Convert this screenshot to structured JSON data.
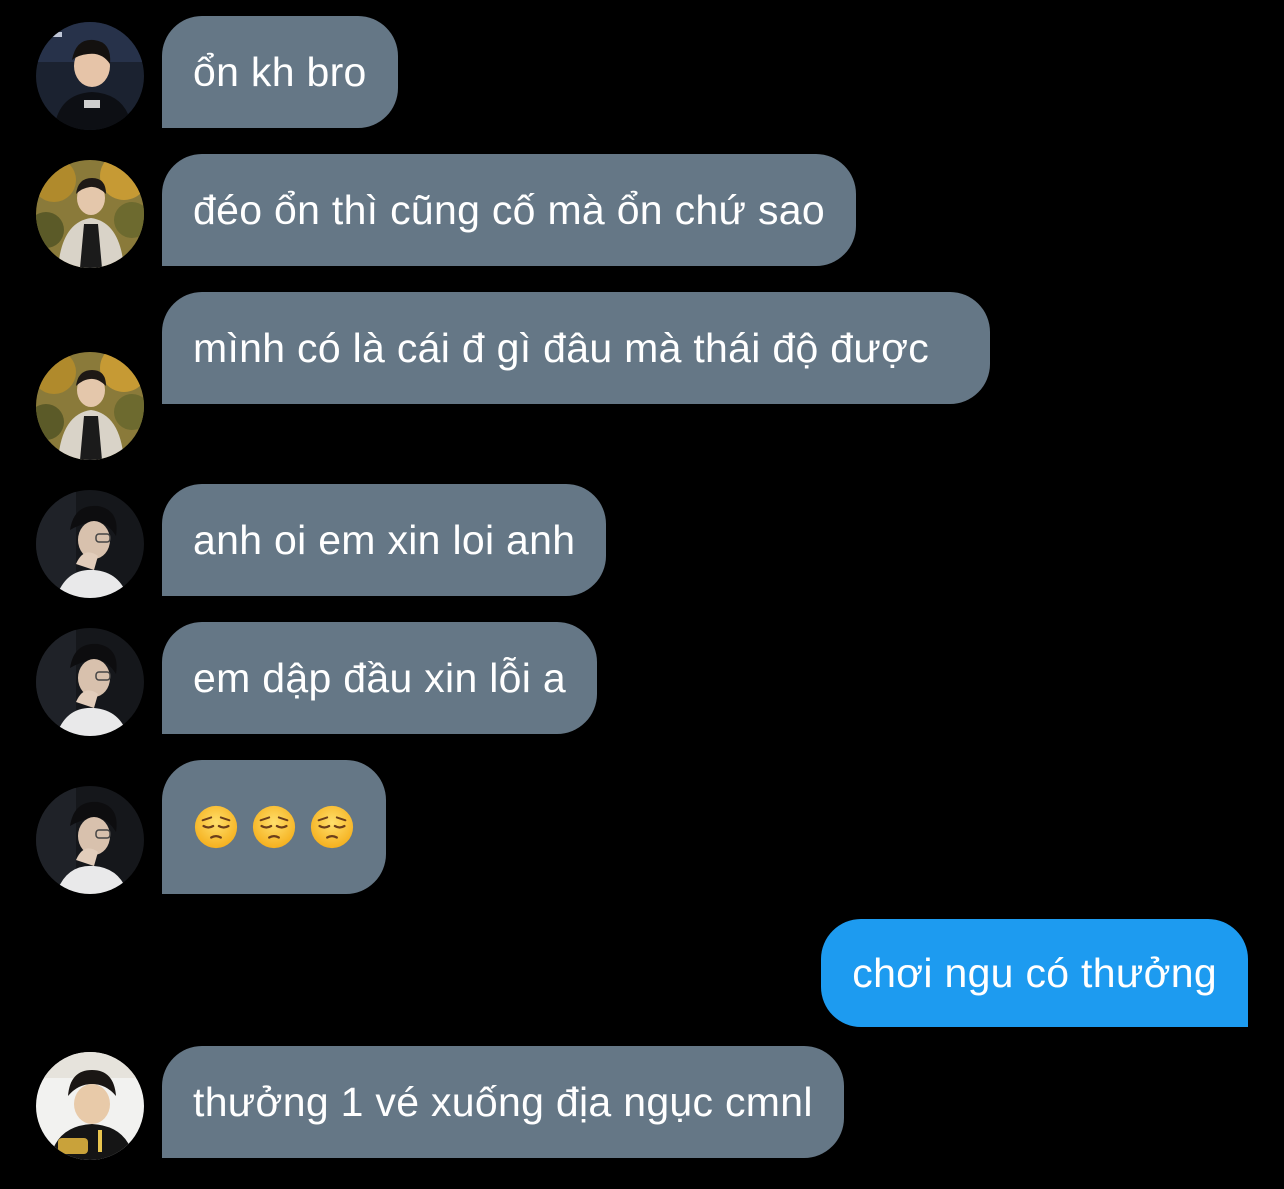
{
  "messages": [
    {
      "direction": "incoming",
      "sender_avatar": "avatar-1",
      "text": "ổn kh bro"
    },
    {
      "direction": "incoming",
      "sender_avatar": "avatar-2",
      "text": "đéo ổn thì cũng cố mà ổn chứ sao"
    },
    {
      "direction": "incoming",
      "sender_avatar": "avatar-2",
      "text": "mình có là cái đ gì đâu mà thái độ được"
    },
    {
      "direction": "incoming",
      "sender_avatar": "avatar-3",
      "text": "anh oi em xin loi anh"
    },
    {
      "direction": "incoming",
      "sender_avatar": "avatar-3",
      "text": "em dập đầu xin lỗi a"
    },
    {
      "direction": "incoming",
      "sender_avatar": "avatar-3",
      "emojis": [
        "pensive-face-emoji",
        "pensive-face-emoji",
        "pensive-face-emoji"
      ]
    },
    {
      "direction": "outgoing",
      "text": "chơi ngu có thưởng"
    },
    {
      "direction": "incoming",
      "sender_avatar": "avatar-4",
      "text": "thưởng 1 vé xuống địa ngục cmnl"
    }
  ],
  "colors": {
    "background": "#000000",
    "incoming_bubble": "#657786",
    "outgoing_bubble": "#1d9bf0",
    "text": "#ffffff"
  }
}
